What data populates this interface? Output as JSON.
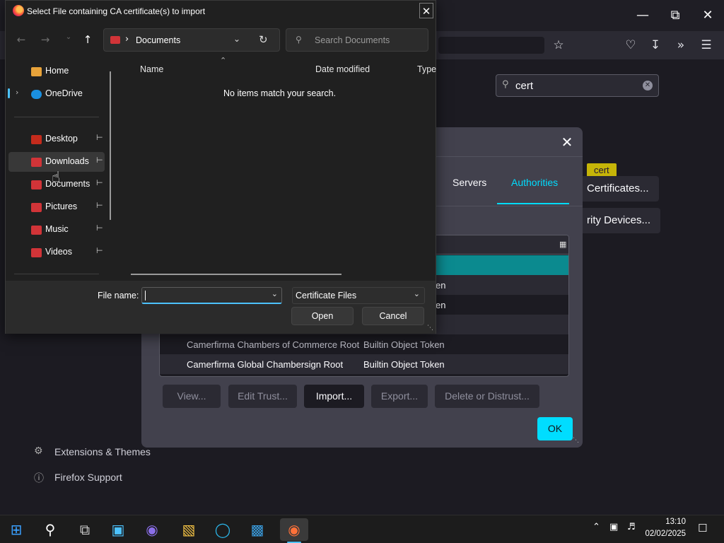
{
  "firefox": {
    "search_value": "cert",
    "highlight_tag": "cert",
    "pref_buttons": {
      "certificates": "Certificates...",
      "security_devices": "rity Devices..."
    },
    "sidebar_links": {
      "extensions": "Extensions & Themes",
      "support": "Firefox Support"
    }
  },
  "cert_manager": {
    "tabs": {
      "servers": "Servers",
      "authorities": "Authorities"
    },
    "rows": [
      {
        "name": "",
        "token": ""
      },
      {
        "name": "",
        "token": "en"
      },
      {
        "name": "",
        "token": "en"
      },
      {
        "name": "",
        "token": ""
      },
      {
        "name": "Camerfirma Chambers of Commerce Root",
        "token": "Builtin Object Token"
      },
      {
        "name": "Camerfirma Global Chambersign Root",
        "token": "Builtin Object Token"
      }
    ],
    "buttons": {
      "view": "View...",
      "edit_trust": "Edit Trust...",
      "import": "Import...",
      "export": "Export...",
      "delete": "Delete or Distrust...",
      "ok": "OK"
    }
  },
  "file_dialog": {
    "title": "Select File containing CA certificate(s) to import",
    "address_path": "Documents",
    "search_placeholder": "Search Documents",
    "nav_items": {
      "home": "Home",
      "onedrive": "OneDrive",
      "desktop": "Desktop",
      "downloads": "Downloads",
      "documents": "Documents",
      "pictures": "Pictures",
      "music": "Music",
      "videos": "Videos"
    },
    "columns": {
      "name": "Name",
      "date_modified": "Date modified",
      "type": "Type"
    },
    "empty_message": "No items match your search.",
    "file_name_label": "File name:",
    "file_name_value": "",
    "filter_selected": "Certificate Files",
    "open_label": "Open",
    "cancel_label": "Cancel"
  },
  "taskbar": {
    "time": "13:10",
    "date": "02/02/2025"
  },
  "colors": {
    "accent": "#00ddff",
    "folder_red": "#d13438",
    "focus_blue": "#4cc2ff"
  }
}
